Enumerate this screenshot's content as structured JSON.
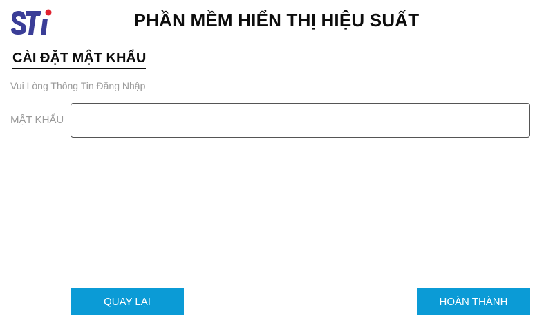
{
  "header": {
    "logo_text": "STi",
    "title": "PHẦN MỀM HIỂN THỊ HIỆU SUẤT"
  },
  "section": {
    "title": "CÀI ĐẶT MẬT KHẨU",
    "instruction": "Vui Lòng Thông Tin Đăng Nhập"
  },
  "form": {
    "password_label": "MẬT KHẨU",
    "password_value": "",
    "password_placeholder": ""
  },
  "actions": {
    "back_label": "QUAY LẠI",
    "done_label": "HOÀN THÀNH"
  },
  "colors": {
    "brand_blue": "#3a3d97",
    "brand_red": "#e0212f",
    "button_blue": "#0b9bd6"
  }
}
